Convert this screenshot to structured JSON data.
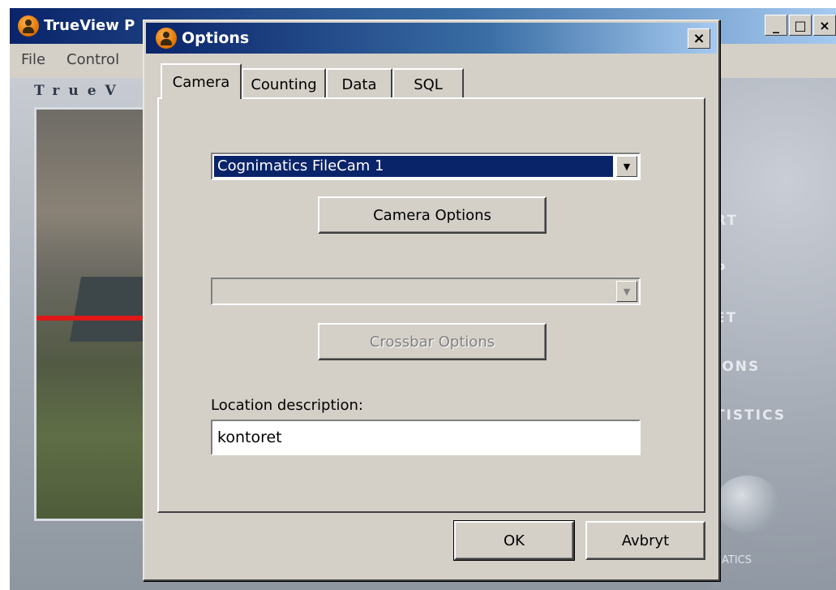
{
  "main_window": {
    "title": "TrueView P",
    "menu": [
      "File",
      "Control"
    ],
    "brand": "TrueV",
    "side_buttons": [
      "RT",
      "P",
      "ET",
      "IONS",
      "TISTICS"
    ],
    "footer_text": "ATICS"
  },
  "dialog": {
    "title": "Options",
    "close_glyph": "×",
    "tabs": [
      "Camera",
      "Counting",
      "Data",
      "SQL"
    ],
    "active_tab": "Camera",
    "camera_select": {
      "value": "Cognimatics FileCam 1"
    },
    "camera_options_button": "Camera Options",
    "crossbar_select": {
      "value": ""
    },
    "crossbar_options_button": "Crossbar Options",
    "location_label": "Location description:",
    "location_value": "kontoret",
    "ok_button": "OK",
    "cancel_button": "Avbryt"
  },
  "colors": {
    "titlebar_start": "#0a246a",
    "titlebar_end": "#a6caf0",
    "face": "#d4d0c8",
    "selection": "#0a246a"
  }
}
